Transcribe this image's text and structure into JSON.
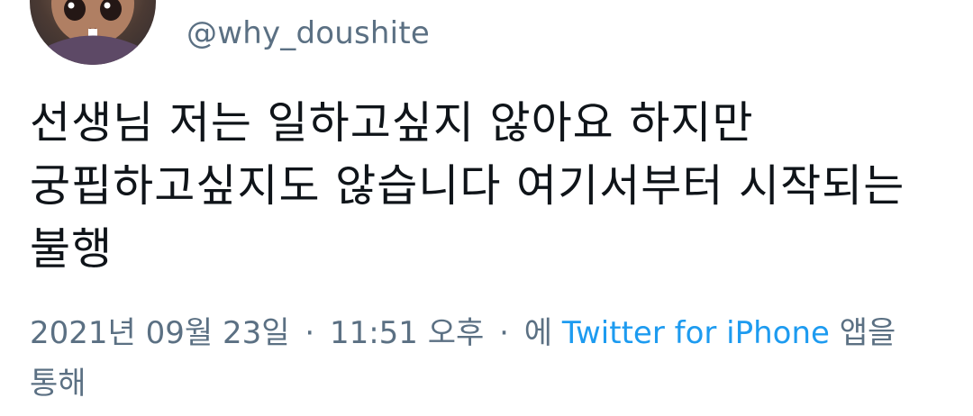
{
  "tweet": {
    "handle": "@why_doushite",
    "text": "선생님 저는 일하고싶지 않아요 하지만 궁핍하고싶지도 않습니다 여기서부터 시작되는 불행",
    "date": "2021년 09월 23일",
    "separator_1": "·",
    "time": "11:51 오후",
    "separator_2": "·",
    "source_prefix": "에",
    "source_app": "Twitter for iPhone",
    "source_suffix": "앱을 통해"
  },
  "colors": {
    "text": "#0f1419",
    "secondary": "#5b7083",
    "link": "#1d9bf0"
  },
  "icons": {
    "avatar": "profile-avatar"
  }
}
